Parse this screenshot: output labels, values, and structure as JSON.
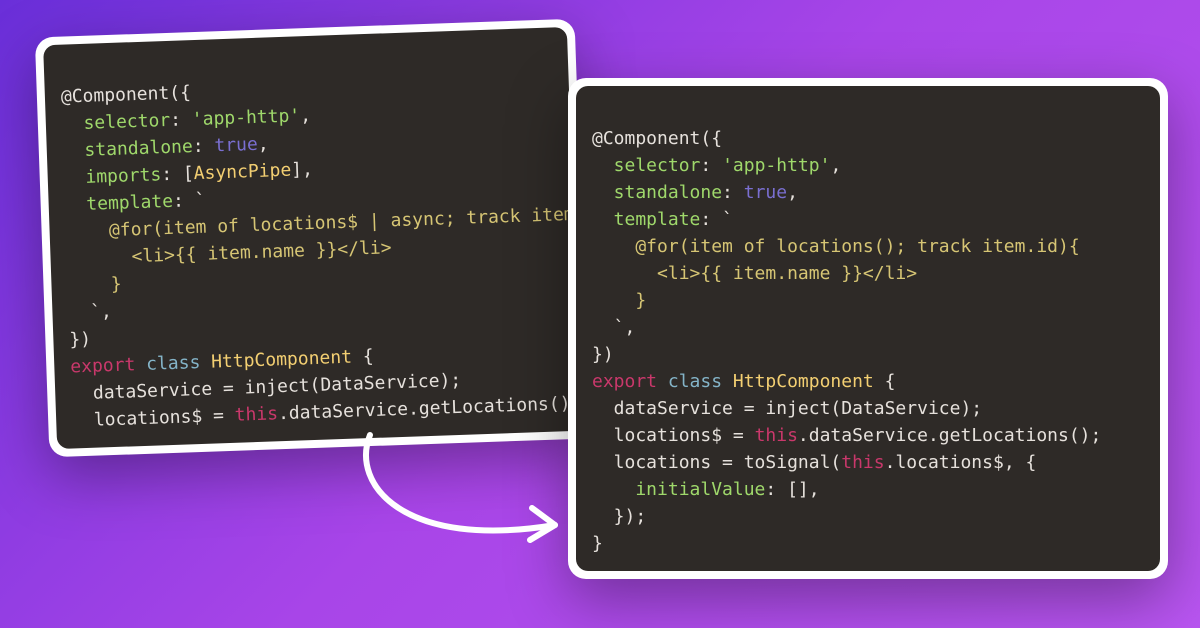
{
  "left": {
    "l1": "@Component({",
    "l2a": "  selector",
    "l2b": ": ",
    "l2c": "'app-http'",
    "l2d": ",",
    "l3a": "  standalone",
    "l3b": ": ",
    "l3c": "true",
    "l3d": ",",
    "l4a": "  imports",
    "l4b": ": [",
    "l4c": "AsyncPipe",
    "l4d": "],",
    "l5a": "  template",
    "l5b": ": `",
    "l6": "    @for(item of locations$ | async; track item.id)",
    "l7": "      <li>{{ item.name }}</li>",
    "l8": "    }",
    "l9": "  `,",
    "l10": "})",
    "l11a": "export",
    "l11b": " class ",
    "l11c": "HttpComponent",
    "l11d": " {",
    "l12": "  dataService = inject(DataService);",
    "l13a": "  locations$ = ",
    "l13b": "this",
    "l13c": ".dataService.getLocations();"
  },
  "right": {
    "l1": "@Component({",
    "l2a": "  selector",
    "l2b": ": ",
    "l2c": "'app-http'",
    "l2d": ",",
    "l3a": "  standalone",
    "l3b": ": ",
    "l3c": "true",
    "l3d": ",",
    "l4a": "  template",
    "l4b": ": `",
    "l5": "    @for(item of locations(); track item.id){",
    "l6": "      <li>{{ item.name }}</li>",
    "l7": "    }",
    "l8": "  `,",
    "l9": "})",
    "l10a": "export",
    "l10b": " class ",
    "l10c": "HttpComponent",
    "l10d": " {",
    "l11": "  dataService = inject(DataService);",
    "l12a": "  locations$ = ",
    "l12b": "this",
    "l12c": ".dataService.getLocations();",
    "l13a": "  locations = toSignal(",
    "l13b": "this",
    "l13c": ".locations$, {",
    "l14a": "    initialValue",
    "l14b": ": [],",
    "l15": "  });",
    "l16": "}"
  }
}
